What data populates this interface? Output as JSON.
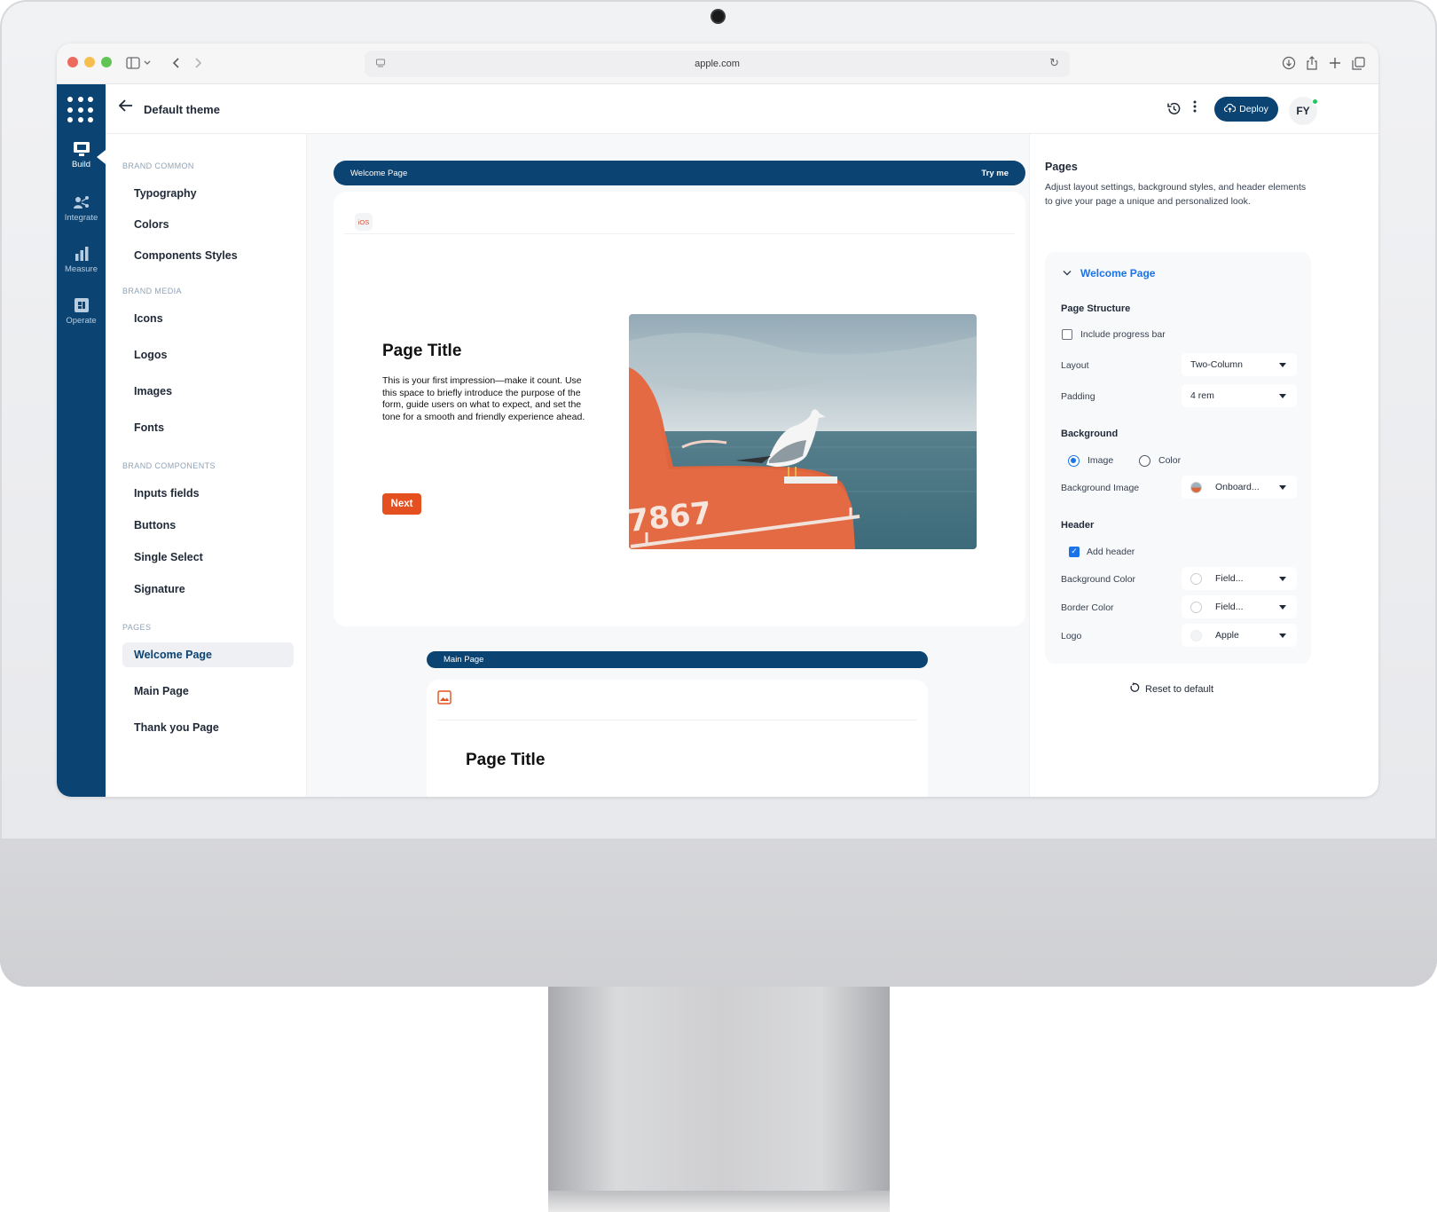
{
  "browser": {
    "url": "apple.com"
  },
  "nav_rail": {
    "items": [
      {
        "label": "Build",
        "icon": "monitor-icon",
        "active": true
      },
      {
        "label": "Integrate",
        "icon": "integrate-icon"
      },
      {
        "label": "Measure",
        "icon": "bar-chart-icon"
      },
      {
        "label": "Operate",
        "icon": "operate-icon"
      }
    ]
  },
  "topbar": {
    "title": "Default theme",
    "deploy_label": "Deploy",
    "avatar_initials": "FY"
  },
  "sidebar": {
    "sections": [
      {
        "heading": "BRAND COMMON",
        "items": [
          "Typography",
          "Colors",
          "Components Styles"
        ]
      },
      {
        "heading": "BRAND MEDIA",
        "items": [
          "Icons",
          "Logos",
          "Images",
          "Fonts"
        ]
      },
      {
        "heading": "BRAND COMPONENTS",
        "items": [
          "Inputs fields",
          "Buttons",
          "Single Select",
          "Signature"
        ]
      },
      {
        "heading": "PAGES",
        "items": [
          "Welcome Page",
          "Main Page",
          "Thank you Page"
        ]
      }
    ],
    "active_item": "Welcome Page"
  },
  "canvas": {
    "welcome": {
      "bar_label": "Welcome Page",
      "try_label": "Try me",
      "logo_text": "iOS",
      "title": "Page Title",
      "description": "This is your first impression—make it count. Use this space to briefly introduce the purpose of the form, guide users on what to expect, and set the tone for a smooth and friendly experience ahead.",
      "next_label": "Next",
      "image_text": "7867"
    },
    "main": {
      "bar_label": "Main Page",
      "title": "Page Title"
    }
  },
  "panel": {
    "title": "Pages",
    "description": "Adjust layout settings, background styles, and header elements to give your page a unique and personalized look.",
    "accordion_title": "Welcome Page",
    "page_structure": {
      "heading": "Page Structure",
      "progress_bar_label": "Include progress bar",
      "progress_bar_checked": false,
      "layout_label": "Layout",
      "layout_value": "Two-Column",
      "padding_label": "Padding",
      "padding_value": "4 rem"
    },
    "background": {
      "heading": "Background",
      "option_image": "Image",
      "option_color": "Color",
      "selected": "Image",
      "image_label": "Background Image",
      "image_value": "Onboard..."
    },
    "header": {
      "heading": "Header",
      "add_header_label": "Add header",
      "add_header_checked": true,
      "bg_color_label": "Background Color",
      "bg_color_value": "Field...",
      "border_color_label": "Border Color",
      "border_color_value": "Field...",
      "logo_label": "Logo",
      "logo_value": "Apple"
    },
    "reset_label": "Reset to default"
  },
  "colors": {
    "brand_navy": "#0b4372",
    "accent_orange": "#e4501f",
    "link_blue": "#1a73e8"
  }
}
